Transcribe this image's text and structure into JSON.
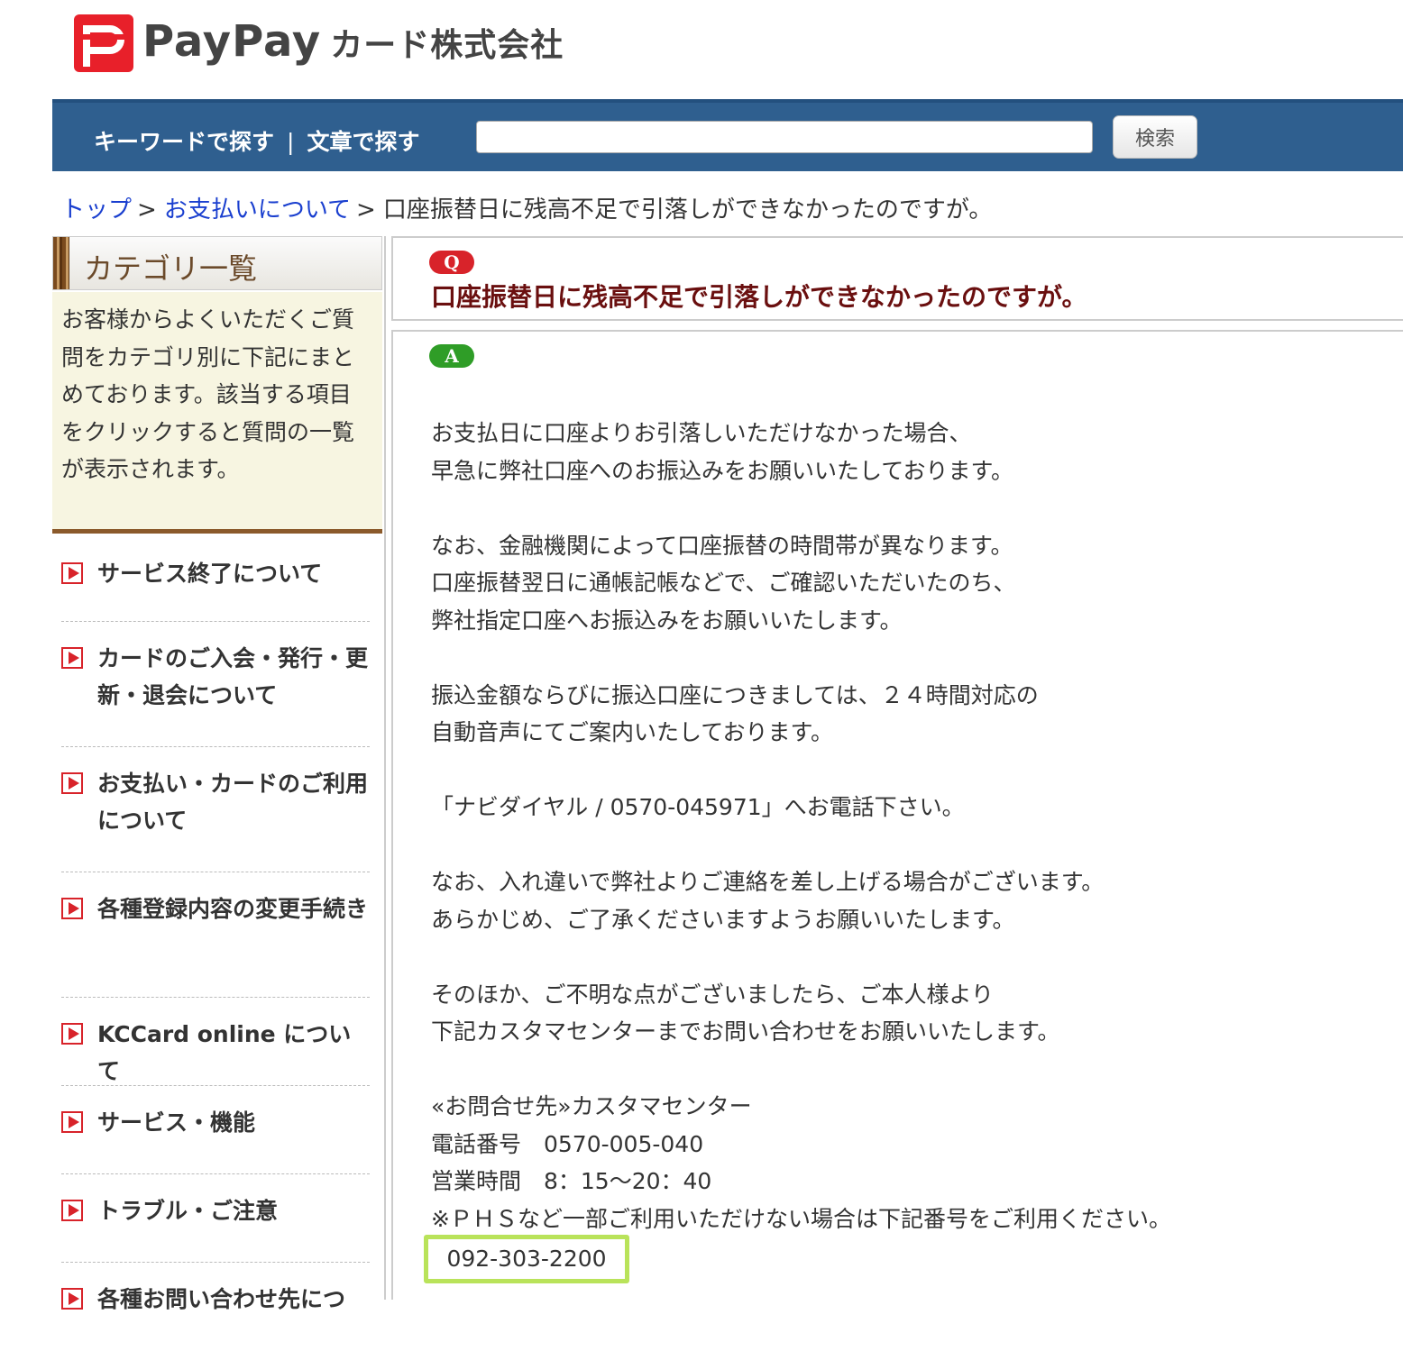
{
  "brand": {
    "logo_text": "PayPay",
    "company": "カード株式会社",
    "colors": {
      "logo_red": "#e8202a",
      "nav_blue": "#2f5f8f",
      "accent_red": "#d8232a",
      "answer_green": "#2f9d27",
      "highlight": "#b9e35a"
    }
  },
  "search": {
    "mode_keyword": "キーワードで探す",
    "separator": "|",
    "mode_sentence": "文章で探す",
    "input_value": "",
    "button_label": "検索"
  },
  "breadcrumb": {
    "top": "トップ",
    "payment": "お支払いについて",
    "current": "口座振替日に残高不足で引落しができなかったのですが。",
    "separator": ">"
  },
  "sidebar": {
    "title": "カテゴリ一覧",
    "description": "お客様からよくいただくご質問をカテゴリ別に下記にまとめております。該当する項目をクリックすると質問の一覧が表示されます。",
    "items": [
      {
        "label": "サービス終了について"
      },
      {
        "label": "カードのご入会・発行・更新・退会について"
      },
      {
        "label": "お支払い・カードのご利用について"
      },
      {
        "label": "各種登録内容の変更手続き"
      },
      {
        "label": "KCCard online について"
      },
      {
        "label": "サービス・機能"
      },
      {
        "label": "トラブル・ご注意"
      },
      {
        "label": "各種お問い合わせ先につ"
      }
    ]
  },
  "question": {
    "badge": "Q",
    "title": "口座振替日に残高不足で引落しができなかったのですが。"
  },
  "answer": {
    "badge": "A",
    "lines": [
      "お支払日に口座よりお引落しいただけなかった場合、",
      "早急に弊社口座へのお振込みをお願いいたしております。",
      "",
      "なお、金融機関によって口座振替の時間帯が異なります。",
      "口座振替翌日に通帳記帳などで、ご確認いただいたのち、",
      "弊社指定口座へお振込みをお願いいたします。",
      "",
      "振込金額ならびに振込口座につきましては、２４時間対応の",
      "自動音声にてご案内いたしております。",
      "",
      "「ナビダイヤル / 0570-045971」へお電話下さい。",
      "",
      "なお、入れ違いで弊社よりご連絡を差し上げる場合がございます。",
      "あらかじめ、ご了承くださいますようお願いいたします。",
      "",
      "そのほか、ご不明な点がございましたら、ご本人様より",
      "下記カスタマセンターまでお問い合わせをお願いいたします。",
      "",
      "«お問合せ先»カスタマセンター",
      "電話番号　0570-005-040",
      "営業時間　8：15～20：40",
      "※ＰＨＳなど一部ご利用いただけない場合は下記番号をご利用ください。"
    ],
    "alt_phone": "092-303-2200"
  }
}
